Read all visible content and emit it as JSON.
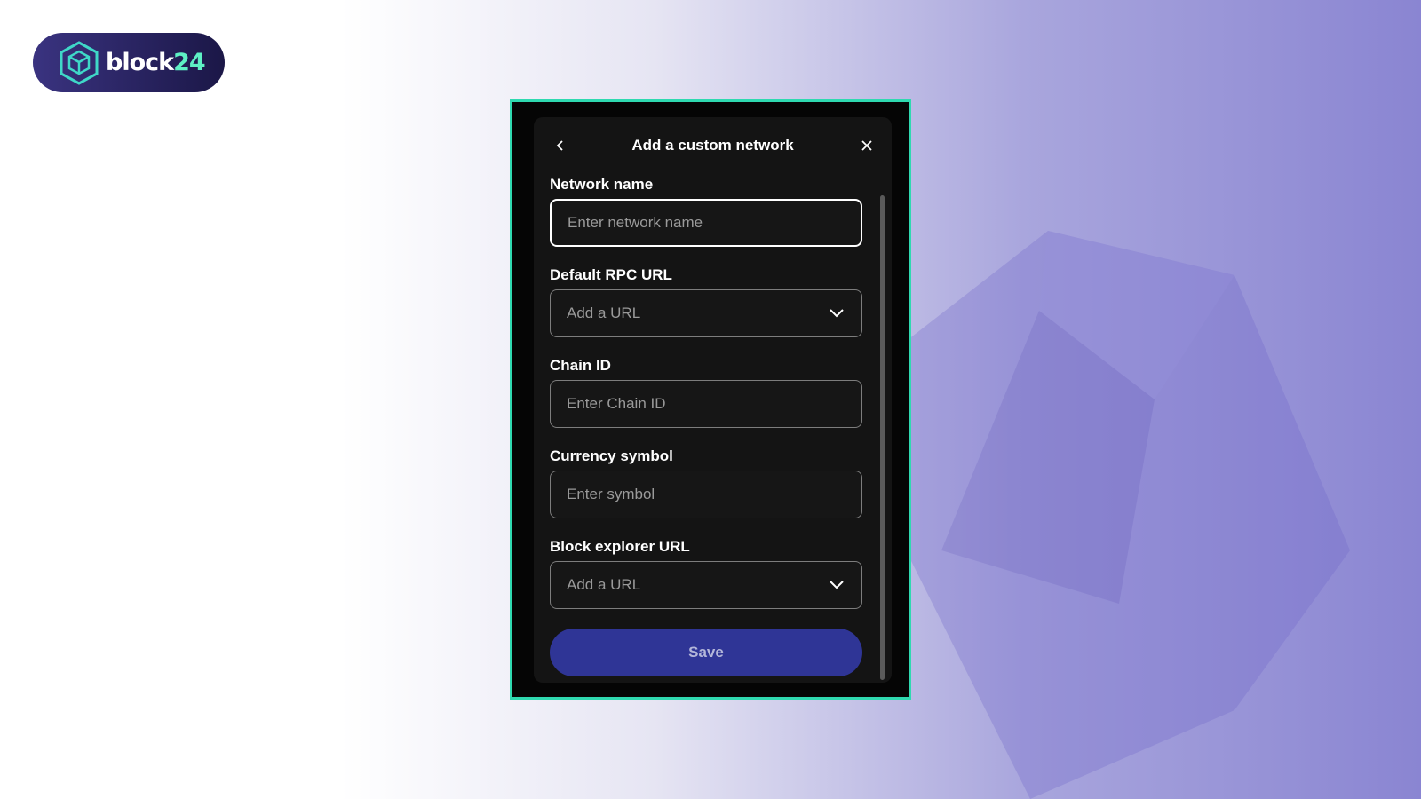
{
  "brand": {
    "logo_text_prefix": "block",
    "logo_text_suffix": "24",
    "accent_color": "#2fd9b0"
  },
  "modal": {
    "title": "Add a custom network",
    "back_icon": "chevron-left-icon",
    "close_icon": "close-icon",
    "fields": {
      "network_name": {
        "label": "Network name",
        "placeholder": "Enter network name"
      },
      "rpc_url": {
        "label": "Default RPC URL",
        "value": "Add a URL"
      },
      "chain_id": {
        "label": "Chain ID",
        "placeholder": "Enter Chain ID"
      },
      "currency_symbol": {
        "label": "Currency symbol",
        "placeholder": "Enter symbol"
      },
      "block_explorer_url": {
        "label": "Block explorer URL",
        "value": "Add a URL"
      }
    },
    "save_label": "Save",
    "save_color": "#2f3596"
  }
}
